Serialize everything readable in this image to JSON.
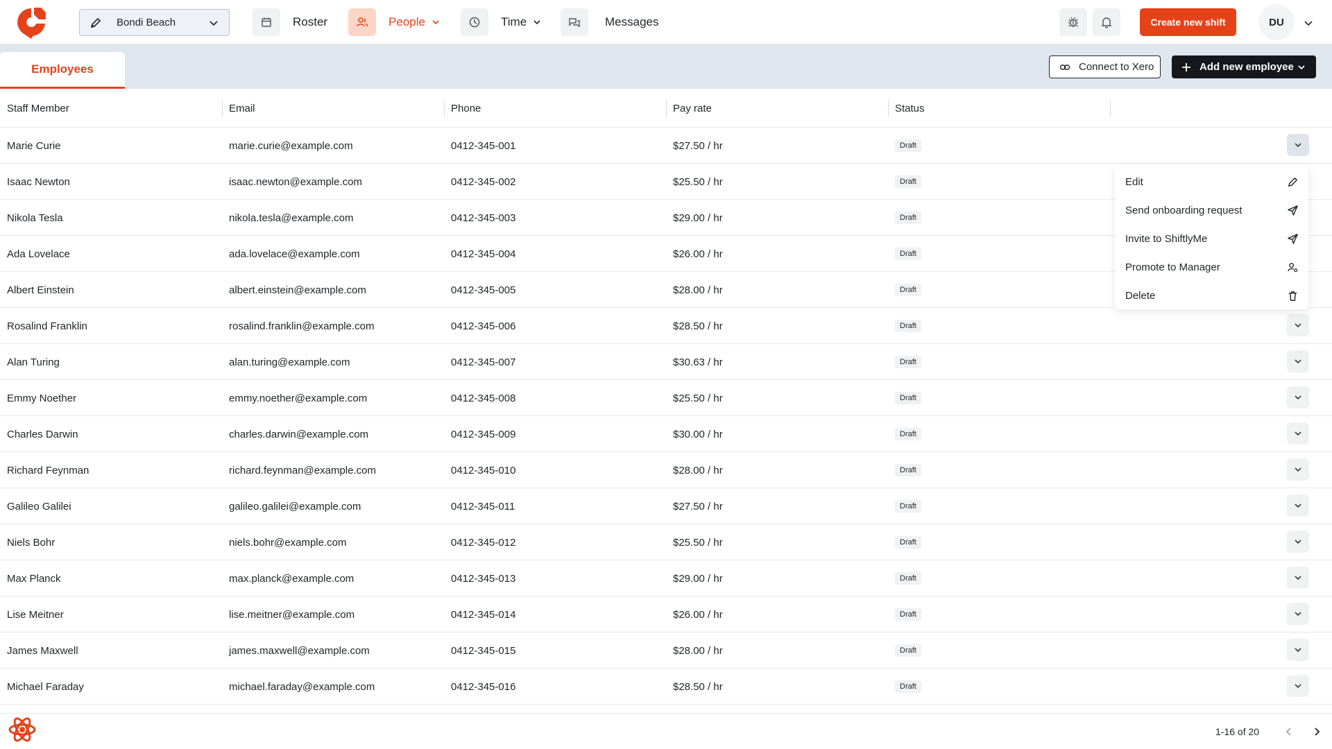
{
  "header": {
    "location": "Bondi Beach",
    "nav": [
      {
        "label": "Roster",
        "icon": "calendar-icon"
      },
      {
        "label": "People",
        "icon": "users-icon"
      },
      {
        "label": "Time",
        "icon": "clock-icon"
      },
      {
        "label": "Messages",
        "icon": "chat-icon"
      }
    ],
    "create_shift_label": "Create new shift",
    "avatar_initials": "DU"
  },
  "subheader": {
    "tab_label": "Employees",
    "connect_xero_label": "Connect to Xero",
    "add_employee_label": "Add new employee"
  },
  "table": {
    "columns": [
      "Staff Member",
      "Email",
      "Phone",
      "Pay rate",
      "Status"
    ],
    "rows": [
      {
        "name": "Marie Curie",
        "email": "marie.curie@example.com",
        "phone": "0412-345-001",
        "pay": "$27.50 / hr",
        "status": "Draft"
      },
      {
        "name": "Isaac Newton",
        "email": "isaac.newton@example.com",
        "phone": "0412-345-002",
        "pay": "$25.50 / hr",
        "status": "Draft"
      },
      {
        "name": "Nikola Tesla",
        "email": "nikola.tesla@example.com",
        "phone": "0412-345-003",
        "pay": "$29.00 / hr",
        "status": "Draft"
      },
      {
        "name": "Ada Lovelace",
        "email": "ada.lovelace@example.com",
        "phone": "0412-345-004",
        "pay": "$26.00 / hr",
        "status": "Draft"
      },
      {
        "name": "Albert Einstein",
        "email": "albert.einstein@example.com",
        "phone": "0412-345-005",
        "pay": "$28.00 / hr",
        "status": "Draft"
      },
      {
        "name": "Rosalind Franklin",
        "email": "rosalind.franklin@example.com",
        "phone": "0412-345-006",
        "pay": "$28.50 / hr",
        "status": "Draft"
      },
      {
        "name": "Alan Turing",
        "email": "alan.turing@example.com",
        "phone": "0412-345-007",
        "pay": "$30.63 / hr",
        "status": "Draft"
      },
      {
        "name": "Emmy Noether",
        "email": "emmy.noether@example.com",
        "phone": "0412-345-008",
        "pay": "$25.50 / hr",
        "status": "Draft"
      },
      {
        "name": "Charles Darwin",
        "email": "charles.darwin@example.com",
        "phone": "0412-345-009",
        "pay": "$30.00 / hr",
        "status": "Draft"
      },
      {
        "name": "Richard Feynman",
        "email": "richard.feynman@example.com",
        "phone": "0412-345-010",
        "pay": "$28.00 / hr",
        "status": "Draft"
      },
      {
        "name": "Galileo Galilei",
        "email": "galileo.galilei@example.com",
        "phone": "0412-345-011",
        "pay": "$27.50 / hr",
        "status": "Draft"
      },
      {
        "name": "Niels Bohr",
        "email": "niels.bohr@example.com",
        "phone": "0412-345-012",
        "pay": "$25.50 / hr",
        "status": "Draft"
      },
      {
        "name": "Max Planck",
        "email": "max.planck@example.com",
        "phone": "0412-345-013",
        "pay": "$29.00 / hr",
        "status": "Draft"
      },
      {
        "name": "Lise Meitner",
        "email": "lise.meitner@example.com",
        "phone": "0412-345-014",
        "pay": "$26.00 / hr",
        "status": "Draft"
      },
      {
        "name": "James Maxwell",
        "email": "james.maxwell@example.com",
        "phone": "0412-345-015",
        "pay": "$28.00 / hr",
        "status": "Draft"
      },
      {
        "name": "Michael Faraday",
        "email": "michael.faraday@example.com",
        "phone": "0412-345-016",
        "pay": "$28.50 / hr",
        "status": "Draft"
      }
    ]
  },
  "row_menu": {
    "open_row": 0,
    "items": [
      {
        "label": "Edit",
        "icon": "pencil-icon"
      },
      {
        "label": "Send onboarding request",
        "icon": "send-icon"
      },
      {
        "label": "Invite to ShiftlyMe",
        "icon": "send-icon"
      },
      {
        "label": "Promote to Manager",
        "icon": "user-cog-icon"
      },
      {
        "label": "Delete",
        "icon": "trash-icon"
      }
    ]
  },
  "footer": {
    "pagination": "1-16 of 20"
  },
  "colors": {
    "accent": "#e5421a",
    "accent_soft": "#fbd5c5",
    "subheader_bg": "#e0e6ee",
    "dark_button": "#14171c"
  }
}
